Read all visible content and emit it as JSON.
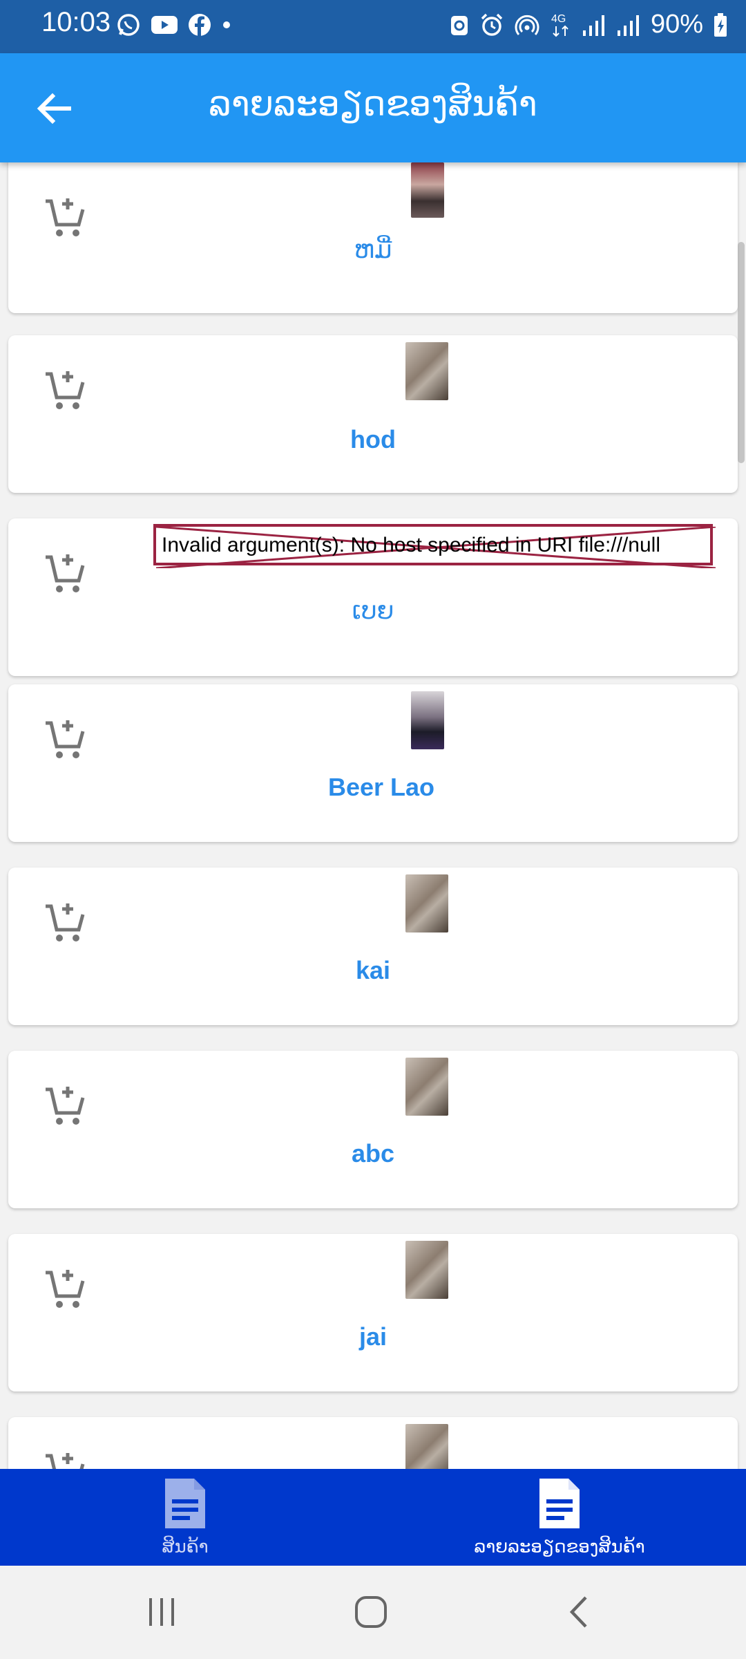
{
  "status_bar": {
    "time": "10:03",
    "left_icons": [
      "whatsapp-icon",
      "youtube-icon",
      "facebook-icon",
      "dot-icon"
    ],
    "right_icons": [
      "sync-icon",
      "alarm-icon",
      "hotspot-icon",
      "4g-icon",
      "signal-icon",
      "signal-icon"
    ],
    "battery": "90%"
  },
  "app_bar": {
    "title": "ລາຍລະອຽດຂອງສິນຄ້າ",
    "back_icon": "arrow-back-icon"
  },
  "products": [
    {
      "name": "ຫມີ່",
      "image": "photo"
    },
    {
      "name": "hod",
      "image": "photo"
    },
    {
      "name": "ເບຍ",
      "image_error": "Invalid argument(s): No host specified in URI file:///null"
    },
    {
      "name": "Beer Lao",
      "image": "photo"
    },
    {
      "name": "kai",
      "image": "photo"
    },
    {
      "name": "abc",
      "image": "photo"
    },
    {
      "name": "jai",
      "image": "photo"
    },
    {
      "name": "",
      "image": "photo"
    }
  ],
  "bottom_nav": {
    "items": [
      {
        "label": "ສິນຄ້າ",
        "icon": "document-icon",
        "active": false
      },
      {
        "label": "ລາຍລະອຽດຂອງສິນຄ້າ",
        "icon": "document-icon",
        "active": true
      }
    ]
  },
  "system_nav": [
    "recents-icon",
    "home-icon",
    "back-icon"
  ],
  "colors": {
    "status_bar": "#1e5fa6",
    "app_bar": "#2196f3",
    "bottom_nav": "#0038cc",
    "product_name": "#2a8be8",
    "error_border": "#9b2342"
  }
}
